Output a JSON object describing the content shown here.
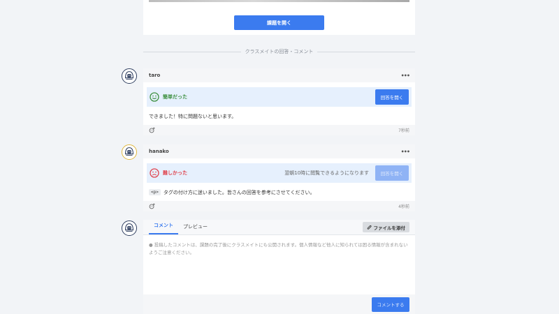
{
  "top": {
    "open_task_label": "課題を開く"
  },
  "divider": {
    "text": "クラスメイトの回答・コメント"
  },
  "posts": [
    {
      "username": "taro",
      "more": "•••",
      "status_label": "簡単だった",
      "status_icon": "smile-icon",
      "status_color": "#3f9142",
      "status_note": "",
      "answer_button_label": "回答を開く",
      "body": "できました！特に問題ないと思います。",
      "time": "7秒前"
    },
    {
      "username": "hanako",
      "more": "•••",
      "status_label": "難しかった",
      "status_icon": "frown-icon",
      "status_color": "#e0434d",
      "status_note": "翌朝10時に閲覧できるようになります",
      "answer_button_label": "回答を開く",
      "body_code": "<p>",
      "body": "タグの付け方に迷いました。皆さんの回答を参考にさせてください。",
      "time": "4秒前"
    }
  ],
  "editor": {
    "tabs": [
      "コメント",
      "プレビュー"
    ],
    "active_tab": "コメント",
    "attach_label": "ファイルを添付",
    "notice": "投稿したコメントは、課題の完了後にクラスメイトにも公開されます。個人情報など他人に知られては困る情報が含まれないようご注意ください。",
    "submit_label": "コメントする"
  },
  "colors": {
    "accent": "#3b7bef",
    "background": "#f2f4f7"
  }
}
